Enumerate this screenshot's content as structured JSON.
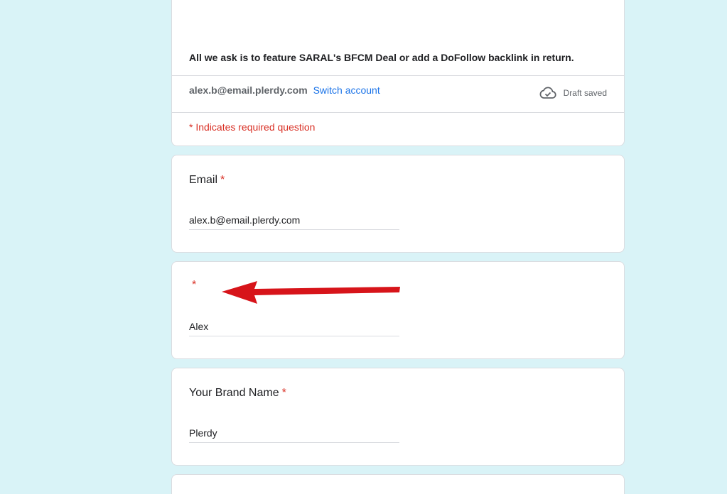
{
  "form": {
    "feature_request": "All we ask is to feature SARAL's BFCM Deal or add a DoFollow backlink in return.",
    "account_email": "alex.b@email.plerdy.com",
    "switch_account": "Switch account",
    "draft_status": "Draft saved",
    "required_note": "* Indicates required question"
  },
  "questions": [
    {
      "title": "Email",
      "required": "*",
      "value": "alex.b@email.plerdy.com"
    },
    {
      "title": "",
      "required": "*",
      "value": "Alex"
    },
    {
      "title": "Your Brand Name",
      "required": "*",
      "value": "Plerdy"
    }
  ],
  "colors": {
    "background": "#d9f3f7",
    "card": "#ffffff",
    "required": "#d93025",
    "link": "#1a73e8",
    "annotation_arrow": "#d7141a"
  },
  "icons": {
    "draft": "cloud-check-icon",
    "annotation": "red-arrow-annotation"
  }
}
